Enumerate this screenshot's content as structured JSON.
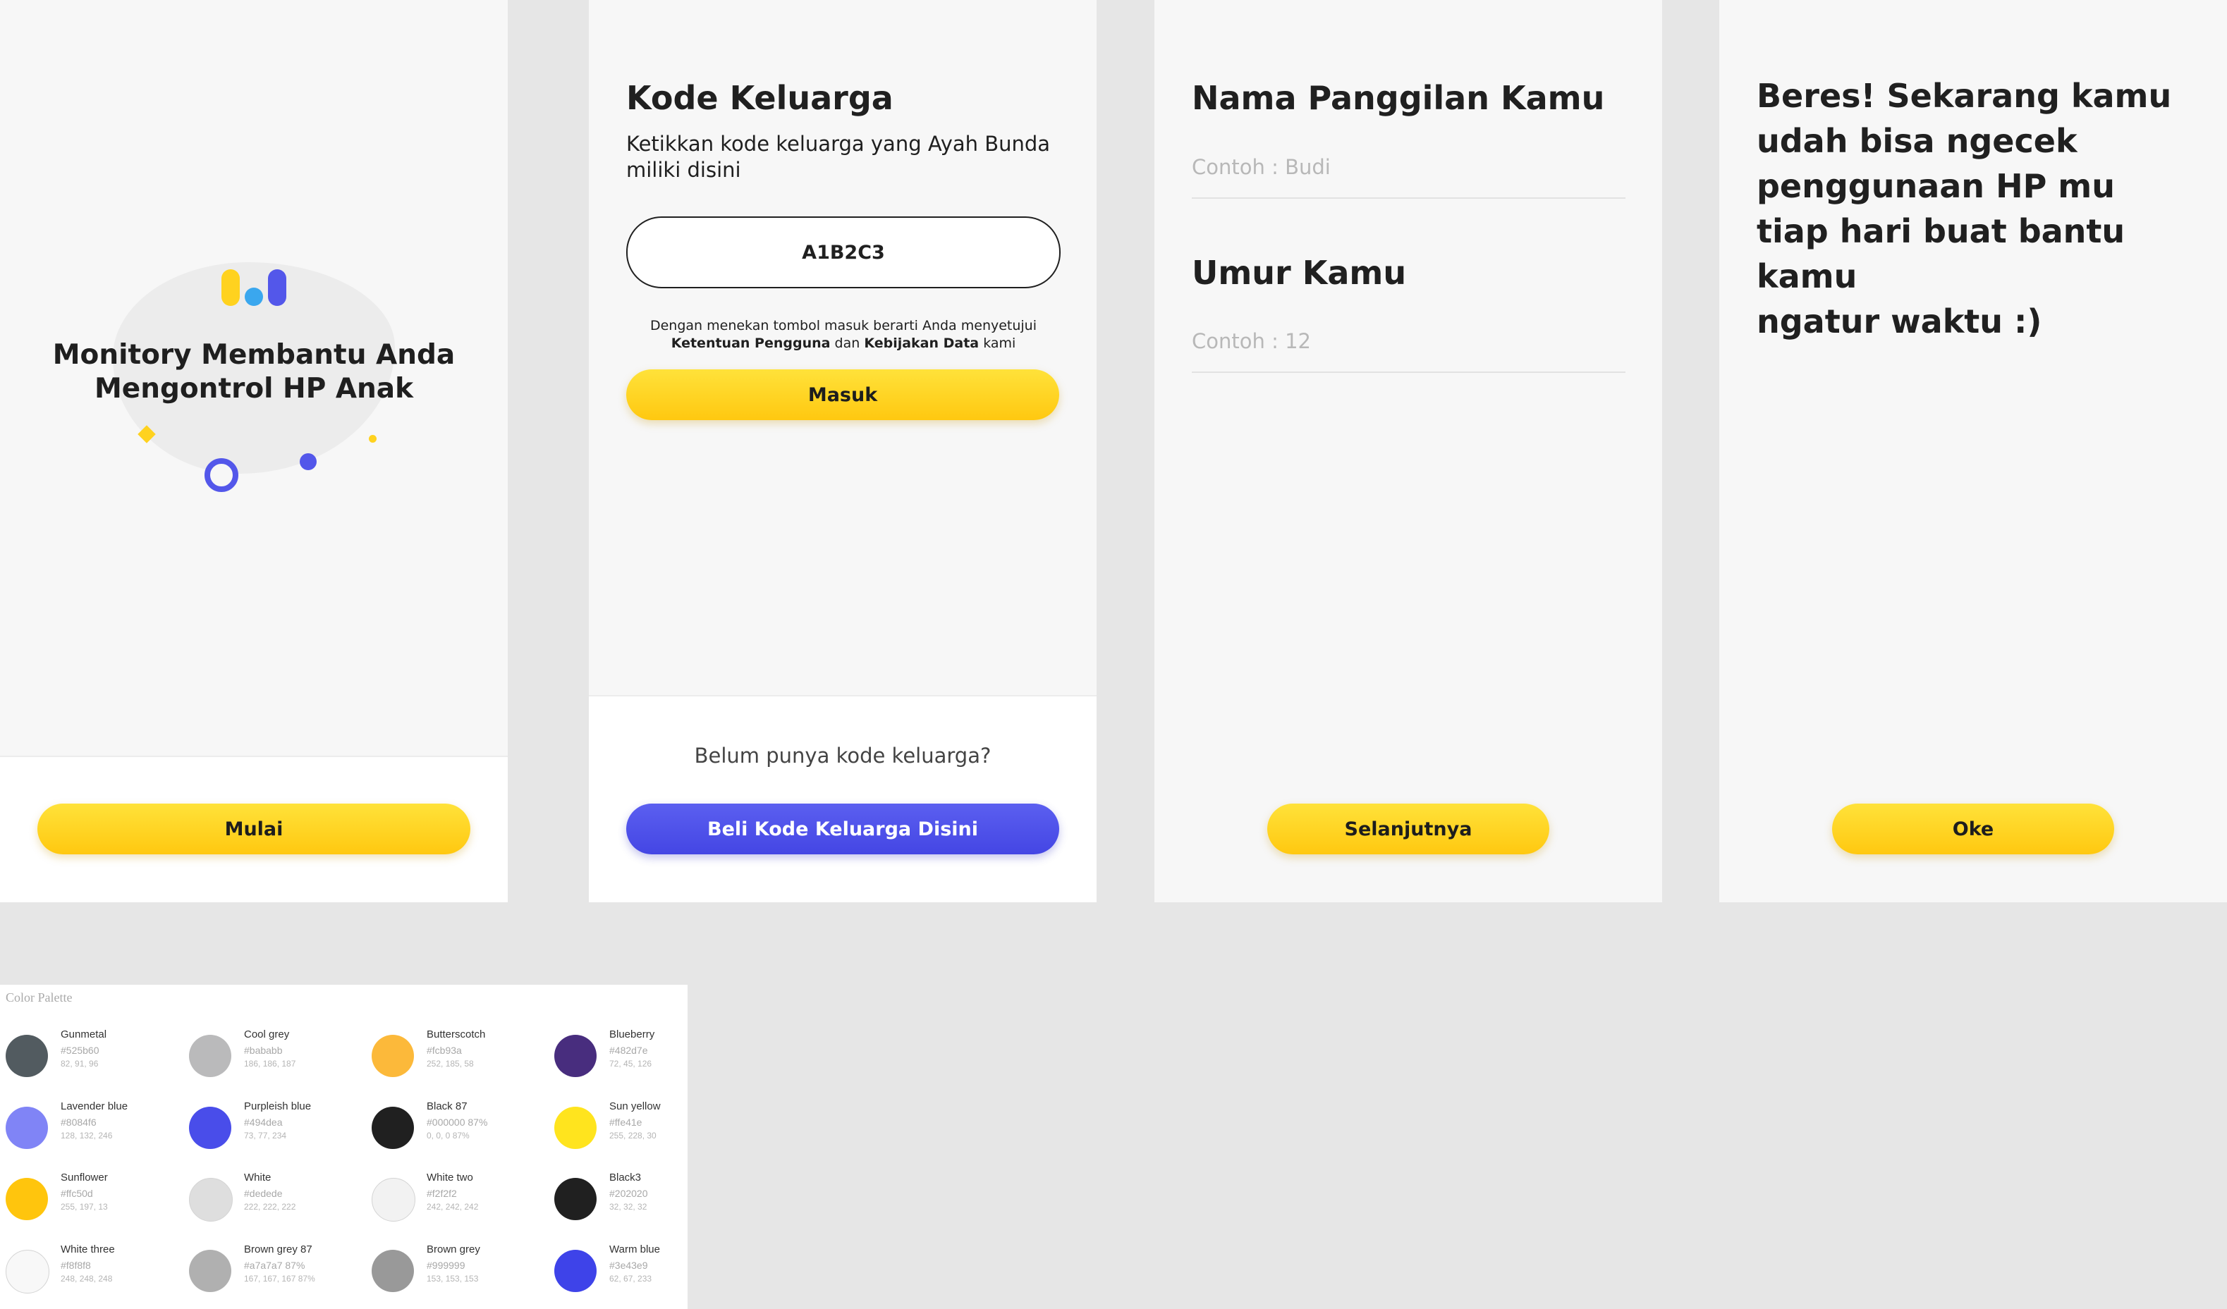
{
  "screen1": {
    "title_line1": "Monitory Membantu Anda",
    "title_line2": "Mengontrol HP Anak",
    "button_label": "Mulai"
  },
  "screen2": {
    "title": "Kode Keluarga",
    "subtitle": "Ketikkan kode keluarga yang Ayah Bunda miliki disini",
    "code_value": "A1B2C3",
    "terms_prefix": "Dengan menekan tombol masuk berarti Anda menyetujui",
    "terms_link1": "Ketentuan Pengguna",
    "terms_and": "dan",
    "terms_link2": "Kebijakan Data",
    "terms_suffix": "kami",
    "login_button": "Masuk",
    "no_code_question": "Belum punya kode keluarga?",
    "buy_button": "Beli Kode Keluarga Disini"
  },
  "screen3": {
    "nickname_title": "Nama Panggilan Kamu",
    "nickname_placeholder": "Contoh : Budi",
    "age_title": "Umur Kamu",
    "age_placeholder": "Contoh : 12",
    "next_button": "Selanjutnya"
  },
  "screen4": {
    "message_lines": [
      "Beres! Sekarang kamu",
      "udah bisa ngecek",
      "penggunaan HP mu",
      "tiap hari buat bantu kamu",
      "ngatur waktu :)"
    ],
    "ok_button": "Oke"
  },
  "palette": {
    "title": "Color Palette",
    "swatches": [
      {
        "name": "Gunmetal",
        "hex": "#525b60",
        "rgb": "82, 91, 96",
        "color": "#525b60"
      },
      {
        "name": "Cool grey",
        "hex": "#bababb",
        "rgb": "186, 186, 187",
        "color": "#bababb"
      },
      {
        "name": "Butterscotch",
        "hex": "#fcb93a",
        "rgb": "252, 185, 58",
        "color": "#fcb93a"
      },
      {
        "name": "Blueberry",
        "hex": "#482d7e",
        "rgb": "72, 45, 126",
        "color": "#482d7e"
      },
      {
        "name": "Lavender blue",
        "hex": "#8084f6",
        "rgb": "128, 132, 246",
        "color": "#8084f6"
      },
      {
        "name": "Purpleish blue",
        "hex": "#494dea",
        "rgb": "73, 77, 234",
        "color": "#494dea"
      },
      {
        "name": "Black 87",
        "hex": "#000000 87%",
        "rgb": "0, 0, 0 87%",
        "color": "#202020"
      },
      {
        "name": "Sun yellow",
        "hex": "#ffe41e",
        "rgb": "255, 228, 30",
        "color": "#ffe41e"
      },
      {
        "name": "Sunflower",
        "hex": "#ffc50d",
        "rgb": "255, 197, 13",
        "color": "#ffc50d"
      },
      {
        "name": "White",
        "hex": "#dedede",
        "rgb": "222, 222, 222",
        "color": "#dedede"
      },
      {
        "name": "White two",
        "hex": "#f2f2f2",
        "rgb": "242, 242, 242",
        "color": "#f2f2f2"
      },
      {
        "name": "Black3",
        "hex": "#202020",
        "rgb": "32, 32, 32",
        "color": "#202020"
      },
      {
        "name": "White three",
        "hex": "#f8f8f8",
        "rgb": "248, 248, 248",
        "color": "#f8f8f8"
      },
      {
        "name": "Brown grey 87",
        "hex": "#a7a7a7 87%",
        "rgb": "167, 167, 167 87%",
        "color": "#b0b0b0"
      },
      {
        "name": "Brown grey",
        "hex": "#999999",
        "rgb": "153, 153, 153",
        "color": "#999999"
      },
      {
        "name": "Warm blue",
        "hex": "#3e43e9",
        "rgb": "62, 67, 233",
        "color": "#3e43e9"
      }
    ]
  }
}
